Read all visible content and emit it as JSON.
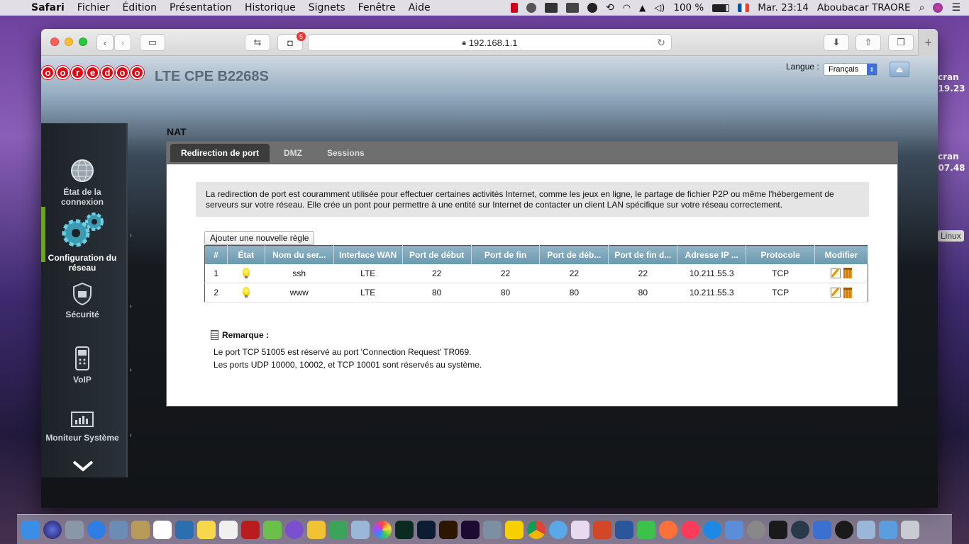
{
  "menubar": {
    "app_name": "Safari",
    "menus": [
      "Fichier",
      "Édition",
      "Présentation",
      "Historique",
      "Signets",
      "Fenêtre",
      "Aide"
    ],
    "battery": "100 %",
    "clock": "Mar. 23:14",
    "user": "Aboubacar TRAORE"
  },
  "desktop": {
    "labels": [
      "cran",
      ".19.23",
      "cran",
      ".07.48"
    ],
    "linux_badge": "Linux"
  },
  "browser": {
    "url": "192.168.1.1",
    "tab_badge_count": "5"
  },
  "router": {
    "logo_letters": [
      "o",
      "o",
      "r",
      "e",
      "d",
      "o",
      "o"
    ],
    "product": "LTE CPE B2268S",
    "language_label": "Langue :",
    "language_value": "Français",
    "nav": [
      {
        "label": "État de la connexion",
        "icon": "globe-icon"
      },
      {
        "label": "Configuration du réseau",
        "icon": "gears-icon"
      },
      {
        "label": "Sécurité",
        "icon": "shield-icon"
      },
      {
        "label": "VoIP",
        "icon": "phone-icon"
      },
      {
        "label": "Moniteur Système",
        "icon": "monitor-icon"
      }
    ],
    "section_title": "NAT",
    "tabs": [
      "Redirection de port",
      "DMZ",
      "Sessions"
    ],
    "active_tab": "Redirection de port",
    "info_text": "La redirection de port est couramment utilisée pour effectuer certaines activités Internet, comme les jeux en ligne, le partage de fichier P2P ou même l'hébergement de serveurs sur votre réseau. Elle crée un pont pour permettre à une entité sur Internet de contacter un client LAN spécifique sur votre réseau correctement.",
    "add_rule_label": "Ajouter une nouvelle règle",
    "table": {
      "headers": [
        "#",
        "État",
        "Nom du ser...",
        "Interface WAN",
        "Port de début",
        "Port de fin",
        "Port de déb...",
        "Port de fin d...",
        "Adresse IP ...",
        "Protocole",
        "Modifier"
      ],
      "rows": [
        {
          "num": "1",
          "name": "ssh",
          "wan": "LTE",
          "start": "22",
          "end": "22",
          "lan_start": "22",
          "lan_end": "22",
          "ip": "10.211.55.3",
          "proto": "TCP"
        },
        {
          "num": "2",
          "name": "www",
          "wan": "LTE",
          "start": "80",
          "end": "80",
          "lan_start": "80",
          "lan_end": "80",
          "ip": "10.211.55.3",
          "proto": "TCP"
        }
      ]
    },
    "note_title": "Remarque :",
    "notes": [
      "Le port TCP 51005 est réservé au port 'Connection Request' TR069.",
      "Les ports UDP 10000, 10002, et TCP 10001 sont réservés au système."
    ]
  },
  "colors": {
    "brand_red": "#e30613",
    "table_header": "#7ba3b8",
    "active_nav": "#6aa51e"
  }
}
